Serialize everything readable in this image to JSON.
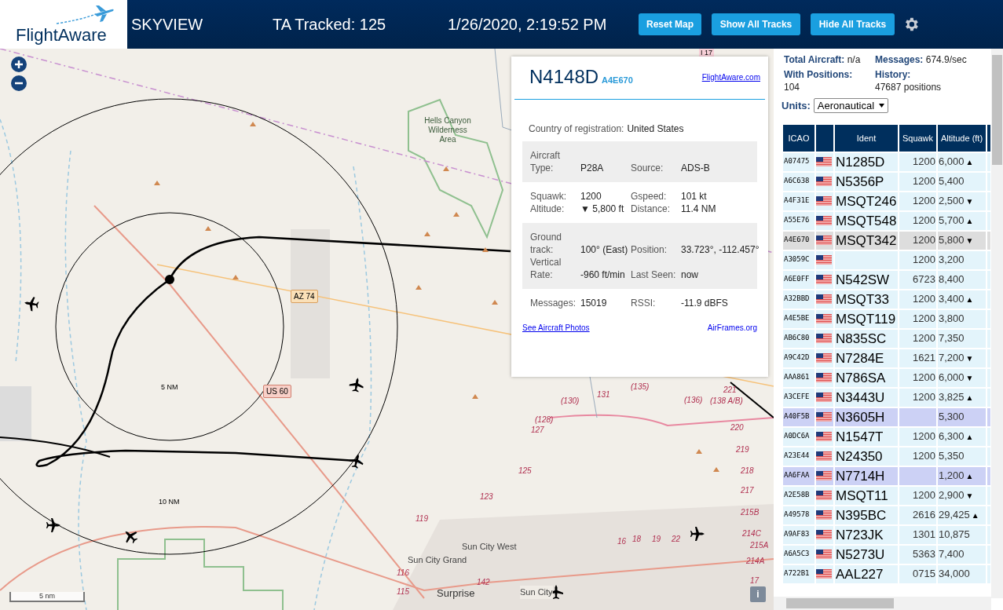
{
  "header": {
    "logo": "FlightAware",
    "title": "SKYVIEW",
    "tracked": "TA Tracked: 125",
    "datetime": "1/26/2020, 2:19:52 PM",
    "buttons": [
      "Reset Map",
      "Show All Tracks",
      "Hide All Tracks"
    ]
  },
  "map": {
    "labels": [
      "Hells Canyon Wilderness Area",
      "AZ 74",
      "US 60",
      "5 NM",
      "10 NM",
      "Sun City West",
      "Sun City Grand",
      "Surprise",
      "Sun City",
      "I 17",
      "(135)",
      "131",
      "(130)",
      "(128)",
      "127",
      "125",
      "123",
      "119",
      "116",
      "115",
      "142",
      "221",
      "(136)",
      "(138 A/B)",
      "220",
      "219",
      "218",
      "217",
      "215B",
      "214C",
      "215A",
      "214A",
      "17",
      "16",
      "18",
      "19",
      "22"
    ],
    "scale": "5 nm",
    "info_button": "i"
  },
  "popup": {
    "ident": "N4148D",
    "icao": "A4E670",
    "link": "FlightAware.com",
    "country_label": "Country of registration:",
    "country": "United States",
    "sections": [
      {
        "shaded": true,
        "fields": [
          {
            "label": "Aircraft Type:",
            "value": "P28A"
          },
          {
            "label": "Source:",
            "value": "ADS-B"
          }
        ]
      },
      {
        "shaded": false,
        "fields": [
          {
            "label": "Squawk:",
            "value": "1200"
          },
          {
            "label": "Gspeed:",
            "value": "101 kt"
          },
          {
            "label": "Altitude:",
            "value": "▼ 5,800 ft"
          },
          {
            "label": "Distance:",
            "value": "11.4 NM"
          }
        ]
      },
      {
        "shaded": true,
        "fields": [
          {
            "label": "Ground track:",
            "value": "100° (East)"
          },
          {
            "label": "Position:",
            "value": "33.723°, -112.457°"
          },
          {
            "label": "Vertical Rate:",
            "value": "-960 ft/min"
          },
          {
            "label": "Last Seen:",
            "value": "now"
          }
        ]
      },
      {
        "shaded": false,
        "fields": [
          {
            "label": "Messages:",
            "value": "15019"
          },
          {
            "label": "RSSI:",
            "value": "-11.9 dBFS"
          }
        ]
      }
    ],
    "photos_link": "See Aircraft Photos",
    "airframes_link": "AirFrames.org"
  },
  "stats": [
    {
      "label": "Total Aircraft:",
      "value": "n/a"
    },
    {
      "label": "Messages:",
      "value": "674.9/sec"
    },
    {
      "label": "With Positions:",
      "value": "104"
    },
    {
      "label": "History:",
      "value": "47687 positions"
    }
  ],
  "units": {
    "label": "Units:",
    "value": "Aeronautical"
  },
  "table": {
    "columns": [
      "ICAO",
      "",
      "Ident",
      "Squawk",
      "Altitude (ft)"
    ],
    "rows": [
      {
        "icao": "A07475",
        "ident": "N1285D",
        "squawk": "1200",
        "altitude": "6,000",
        "trend": "▲",
        "selected": false,
        "highlight": false
      },
      {
        "icao": "A6C638",
        "ident": "N5356P",
        "squawk": "1200",
        "altitude": "5,400",
        "trend": "",
        "selected": false,
        "highlight": false
      },
      {
        "icao": "A4F31E",
        "ident": "MSQT246",
        "squawk": "1200",
        "altitude": "2,500",
        "trend": "▼",
        "selected": false,
        "highlight": false
      },
      {
        "icao": "A55E76",
        "ident": "MSQT548",
        "squawk": "1200",
        "altitude": "5,700",
        "trend": "▲",
        "selected": false,
        "highlight": false
      },
      {
        "icao": "A4E670",
        "ident": "MSQT342",
        "squawk": "1200",
        "altitude": "5,800",
        "trend": "▼",
        "selected": true,
        "highlight": false
      },
      {
        "icao": "A3059C",
        "ident": "",
        "squawk": "1200",
        "altitude": "3,200",
        "trend": "",
        "selected": false,
        "highlight": false
      },
      {
        "icao": "A6E0FF",
        "ident": "N542SW",
        "squawk": "6723",
        "altitude": "8,400",
        "trend": "",
        "selected": false,
        "highlight": false
      },
      {
        "icao": "A32BBD",
        "ident": "MSQT33",
        "squawk": "1200",
        "altitude": "3,400",
        "trend": "▲",
        "selected": false,
        "highlight": false
      },
      {
        "icao": "A4E5BE",
        "ident": "MSQT119",
        "squawk": "1200",
        "altitude": "3,800",
        "trend": "",
        "selected": false,
        "highlight": false
      },
      {
        "icao": "AB6C80",
        "ident": "N835SC",
        "squawk": "1200",
        "altitude": "7,350",
        "trend": "",
        "selected": false,
        "highlight": false
      },
      {
        "icao": "A9C42D",
        "ident": "N7284E",
        "squawk": "1621",
        "altitude": "7,200",
        "trend": "▼",
        "selected": false,
        "highlight": false
      },
      {
        "icao": "AAA861",
        "ident": "N786SA",
        "squawk": "1200",
        "altitude": "6,000",
        "trend": "▼",
        "selected": false,
        "highlight": false
      },
      {
        "icao": "A3CEFE",
        "ident": "N3443U",
        "squawk": "1200",
        "altitude": "3,825",
        "trend": "▲",
        "selected": false,
        "highlight": false
      },
      {
        "icao": "A40F5B",
        "ident": "N3605H",
        "squawk": "",
        "altitude": "5,300",
        "trend": "",
        "selected": false,
        "highlight": true
      },
      {
        "icao": "A0DC6A",
        "ident": "N1547T",
        "squawk": "1200",
        "altitude": "6,300",
        "trend": "▲",
        "selected": false,
        "highlight": false
      },
      {
        "icao": "A23E44",
        "ident": "N24350",
        "squawk": "1200",
        "altitude": "5,350",
        "trend": "",
        "selected": false,
        "highlight": false
      },
      {
        "icao": "AA6FAA",
        "ident": "N7714H",
        "squawk": "",
        "altitude": "1,200",
        "trend": "▲",
        "selected": false,
        "highlight": true
      },
      {
        "icao": "A2E58B",
        "ident": "MSQT11",
        "squawk": "1200",
        "altitude": "2,900",
        "trend": "▼",
        "selected": false,
        "highlight": false
      },
      {
        "icao": "A49578",
        "ident": "N395BC",
        "squawk": "2616",
        "altitude": "29,425",
        "trend": "▲",
        "selected": false,
        "highlight": false
      },
      {
        "icao": "A9AF83",
        "ident": "N723JK",
        "squawk": "1301",
        "altitude": "10,875",
        "trend": "",
        "selected": false,
        "highlight": false
      },
      {
        "icao": "A6A5C3",
        "ident": "N5273U",
        "squawk": "5363",
        "altitude": "7,400",
        "trend": "",
        "selected": false,
        "highlight": false
      },
      {
        "icao": "A722B1",
        "ident": "AAL227",
        "squawk": "0715",
        "altitude": "34,000",
        "trend": "",
        "selected": false,
        "highlight": false
      }
    ]
  }
}
